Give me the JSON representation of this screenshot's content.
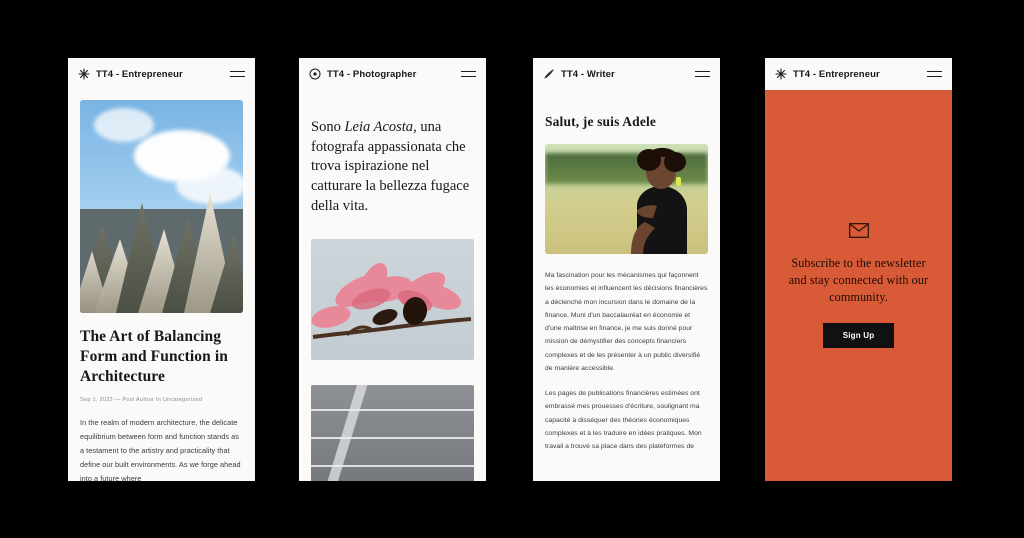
{
  "phones": [
    {
      "id": "entrepreneur-post",
      "header": {
        "icon": "asterisk-icon",
        "title": "TT4 - Entrepreneur",
        "menu_icon": "hamburger-menu-icon"
      },
      "hero_image_alt": "angular architectural spires against blue sky with clouds",
      "post": {
        "title": "The Art of Balancing Form and Function in Architecture",
        "meta": "Sep 1, 2023 — Post Author In Uncategorized",
        "body": "In the realm of modern architecture, the delicate equilibrium between form and function stands as a testament to the artistry and practicality that define our built environments. As we forge ahead into a future where"
      }
    },
    {
      "id": "photographer",
      "header": {
        "icon": "aperture-icon",
        "title": "TT4 - Photographer",
        "menu_icon": "hamburger-menu-icon"
      },
      "intro_prefix": "Sono ",
      "intro_name": "Leia Acosta",
      "intro_suffix": ", una fotografa appassionata che trova ispirazione nel catturare la bellezza fugace della vita.",
      "image_one_alt": "pink magnolia blossoms on a branch",
      "image_two_alt": "concrete stairs with diagonal light"
    },
    {
      "id": "writer",
      "header": {
        "icon": "pen-icon",
        "title": "TT4 - Writer",
        "menu_icon": "hamburger-menu-icon"
      },
      "title": "Salut, je suis Adele",
      "portrait_alt": "smiling woman in black dress standing in a sunlit field",
      "paragraph_one": "Ma fascination pour les mécanismes qui façonnent les économies et influencent les décisions financières a déclenché mon incursion dans le domaine de la finance. Muni d'un baccalauréat en économie et d'une maîtrise en finance, je me suis donné pour mission de démystifier des concepts financiers complexes et de les présenter à un public diversifié de manière accessible.",
      "paragraph_two": "Les pages de publications financières estimées ont embrassé mes prouesses d'écriture, soulignant ma capacité à disséquer des théories économiques complexes et à les traduire en idées pratiques. Mon travail a trouvé sa place dans des plateformes de"
    },
    {
      "id": "newsletter",
      "header": {
        "icon": "asterisk-icon",
        "title": "TT4 - Entrepreneur",
        "menu_icon": "hamburger-menu-icon"
      },
      "panel": {
        "icon": "envelope-icon",
        "message": "Subscribe to the newsletter and stay connected with our community.",
        "button_label": "Sign Up",
        "background_color": "#d95a37",
        "button_color": "#111012"
      }
    }
  ]
}
